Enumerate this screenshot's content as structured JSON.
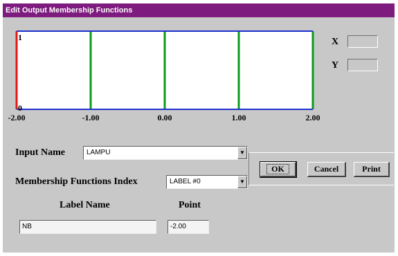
{
  "window": {
    "title": "Edit Output Membership Functions"
  },
  "plot": {
    "y_max_label": "1",
    "y_min_label": "0",
    "x_tick_labels": [
      "-2.00",
      "-1.00",
      "0.00",
      "1.00",
      "2.00"
    ],
    "x_values": [
      -2,
      -1,
      0,
      1,
      2
    ],
    "xlim": [
      -2,
      2
    ],
    "ylim": [
      0,
      1
    ],
    "colors": {
      "frame": "#1f2fd0",
      "red_line": "#e01818",
      "green_line": "#0c9a1c"
    }
  },
  "readout": {
    "x_label": "X",
    "y_label": "Y",
    "x_value": "",
    "y_value": ""
  },
  "input_name": {
    "label": "Input Name",
    "value": "LAMPU"
  },
  "mf_index": {
    "label": "Membership Functions Index",
    "value": "LABEL #0"
  },
  "label_name": {
    "header": "Label Name",
    "value": "NB"
  },
  "point": {
    "header": "Point",
    "value": "-2.00"
  },
  "buttons": {
    "ok": "OK",
    "cancel": "Cancel",
    "print": "Print"
  }
}
